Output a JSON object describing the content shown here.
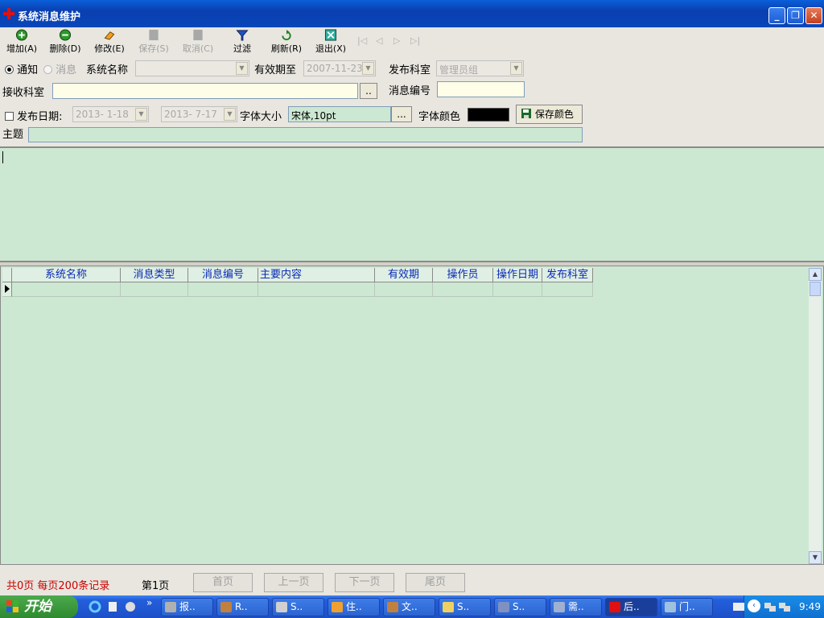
{
  "window": {
    "title": "系统消息维护",
    "min": "_",
    "restore": "❐",
    "close": "✕"
  },
  "toolbar": {
    "add": "增加(A)",
    "delete": "删除(D)",
    "edit": "修改(E)",
    "save": "保存(S)",
    "cancel": "取消(C)",
    "filter": "过滤",
    "refresh": "刷新(R)",
    "exit": "退出(X)",
    "nav_first": "|◁",
    "nav_prev": "◁",
    "nav_next": "▷",
    "nav_last": "▷|"
  },
  "form": {
    "radio_notice": "通知",
    "radio_message": "消息",
    "system_name_label": "系统名称",
    "system_name_value": "",
    "valid_until_label": "有效期至",
    "valid_until_value": "2007-11-23",
    "dept_label": "发布科室",
    "dept_value": "管理员组",
    "recv_dept_label": "接收科室",
    "recv_dept_value": "",
    "dots": "..",
    "msg_no_label": "消息编号",
    "msg_no_value": "",
    "publish_date_label": "发布日期:",
    "date_from": "2013- 1-18",
    "date_to": "2013- 7-17",
    "font_size_label": "字体大小",
    "font_size_value": "宋体,10pt",
    "font_btn": "...",
    "font_color_label": "字体颜色",
    "font_color": "#000000",
    "save_color_label": "保存颜色",
    "subject_label": "主题",
    "subject_value": ""
  },
  "grid": {
    "columns": [
      "系统名称",
      "消息类型",
      "消息编号",
      "主要内容",
      "有效期",
      "操作员",
      "操作日期",
      "发布科室"
    ],
    "rows": []
  },
  "status": {
    "summary": "共0页  每页200条记录",
    "current_page": "第1页",
    "first": "首页",
    "prev": "上一页",
    "next": "下一页",
    "last": "尾页"
  },
  "taskbar": {
    "start": "开始",
    "more": "»",
    "tasks": [
      "报..",
      "R..",
      "S..",
      "住..",
      "文..",
      "S..",
      "S..",
      "需..",
      "后..",
      "门.."
    ],
    "clock": "9:49"
  },
  "colors": {
    "accent": "#0a3fb0",
    "panel_green": "#cde8d2",
    "header_blue": "#0a2ab8",
    "summary_red": "#cc0000"
  }
}
